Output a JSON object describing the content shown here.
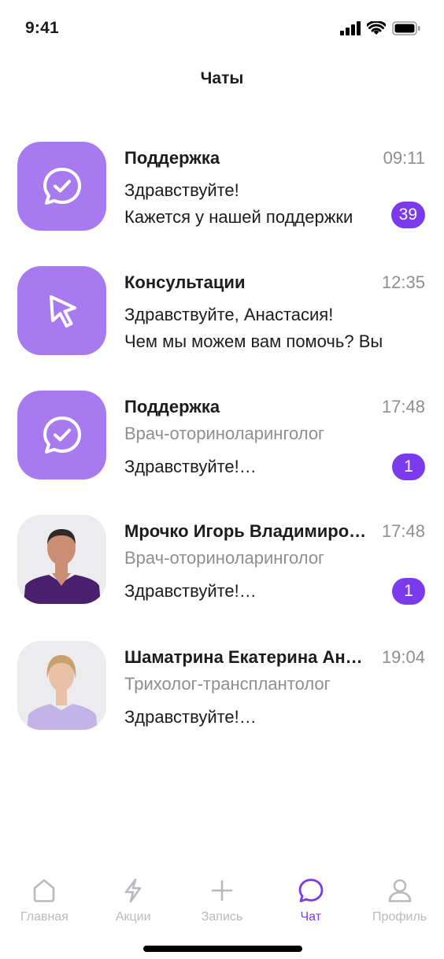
{
  "status_bar": {
    "time": "9:41"
  },
  "header": {
    "title": "Чаты"
  },
  "chats": [
    {
      "name": "Поддержка",
      "time": "09:11",
      "line1": "Здравствуйте!",
      "line2": "Кажется у нашей поддержки",
      "badge": "39",
      "avatar_icon": "chat-check-icon"
    },
    {
      "name": "Консультации",
      "time": "12:35",
      "line1": "Здравствуйте, Анастасия!",
      "line2": "Чем мы можем вам помочь? Вы",
      "avatar_icon": "cursor-icon"
    },
    {
      "name": "Поддержка",
      "time": "17:48",
      "subtitle": "Врач-оториноларинголог",
      "line2": "Здравствуйте!…",
      "badge": "1",
      "avatar_icon": "chat-check-icon"
    },
    {
      "name": "Мрочко Игорь Владимирович",
      "time": "17:48",
      "subtitle": "Врач-оториноларинголог",
      "line2": "Здравствуйте!…",
      "badge": "1",
      "avatar_icon": "doctor-photo-male"
    },
    {
      "name": "Шаматрина Екатерина Андреевна",
      "time": "19:04",
      "subtitle": "Трихолог-трансплантолог",
      "line2": "Здравствуйте!…",
      "avatar_icon": "doctor-photo-female"
    }
  ],
  "tab_bar": {
    "items": [
      {
        "label": "Главная",
        "icon": "home-icon"
      },
      {
        "label": "Акции",
        "icon": "lightning-icon"
      },
      {
        "label": "Запись",
        "icon": "plus-icon"
      },
      {
        "label": "Чат",
        "icon": "chat-icon",
        "active": true
      },
      {
        "label": "Профиль",
        "icon": "profile-icon"
      }
    ]
  },
  "colors": {
    "accent": "#7c3aed",
    "avatar_bg": "#a87af0",
    "muted": "#8e8e93"
  }
}
